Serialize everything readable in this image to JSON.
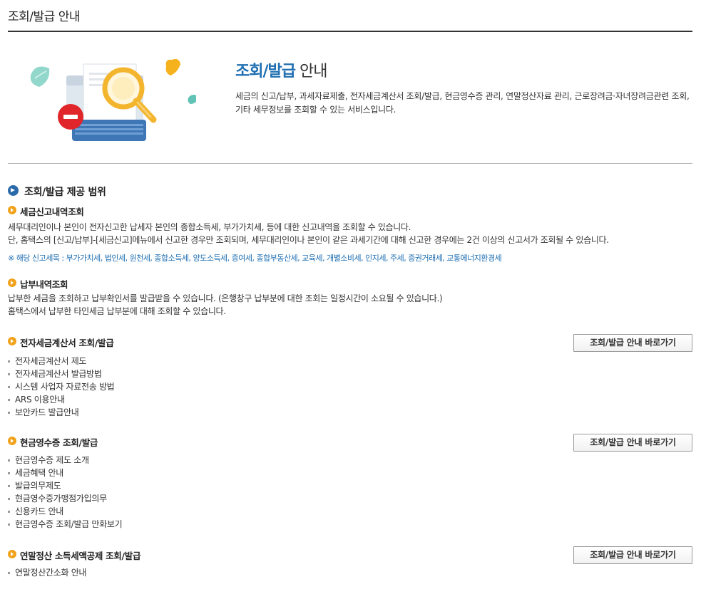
{
  "page": {
    "title": "조회/발급 안내"
  },
  "intro": {
    "title_accent": "조회/발급",
    "title_rest": " 안내",
    "description": "세금의 신고/납부, 과세자료제출, 전자세금계산서 조회/발급, 현금영수증 관리, 연말정산자료 관리, 근로장려금·자녀장려금관련 조회, 기타 세무정보를 조회할 수 있는 서비스입니다."
  },
  "scope": {
    "title": "조회/발급 제공 범위",
    "tax_report": {
      "title": "세금신고내역조회",
      "line1": "세무대리인이나 본인이 전자신고한 납세자 본인의 종합소득세, 부가가치세, 등에 대한 신고내역을 조회할 수 있습니다.",
      "line2": "단, 홈택스의 [신고/납부]-[세금신고]메뉴에서 신고한 경우만 조회되며, 세무대리인이나 본인이 같은 과세기간에 대해 신고한 경우에는 2건 이상의 신고서가 조회될 수 있습니다.",
      "note": "※ 해당 신고세목 : 부가가치세, 법인세, 원천세, 종합소득세, 양도소득세, 증여세, 종합부동산세, 교육세, 개별소비세, 인지세, 주세, 증권거래세, 교통에너지환경세"
    },
    "payment": {
      "title": "납부내역조회",
      "line1": "납부한 세금을 조회하고 납부확인서를 발급받을 수 있습니다. (은행창구 납부분에 대한 조회는 일정시간이 소요될 수 있습니다.)",
      "line2": "홈택스에서 납부한 타인세금 납부분에 대해 조회할 수 있습니다."
    },
    "e_invoice": {
      "title": "전자세금계산서 조회/발급",
      "button": "조회/발급 안내 바로가기",
      "items": [
        "전자세금계산서 제도",
        "전자세금계산서 발급방법",
        "시스템 사업자 자료전송 방법",
        "ARS 이용안내",
        "보안카드 발급안내"
      ]
    },
    "cash_receipt": {
      "title": "현금영수증 조회/발급",
      "button": "조회/발급 안내 바로가기",
      "items": [
        "현금영수증 제도 소개",
        "세금혜택 안내",
        "발급의무제도",
        "현금영수증가맹점가입의무",
        "신용카드 안내",
        "현금영수증 조회/발급 만화보기"
      ]
    },
    "year_end": {
      "title": "연말정산 소득세액공제 조회/발급",
      "button": "조회/발급 안내 바로가기",
      "items": [
        "연말정산간소화 안내"
      ]
    }
  },
  "colors": {
    "accent": "#1f6fb2",
    "orange_bullet": "#f0a21b",
    "blue_bullet": "#2b6aa8"
  }
}
